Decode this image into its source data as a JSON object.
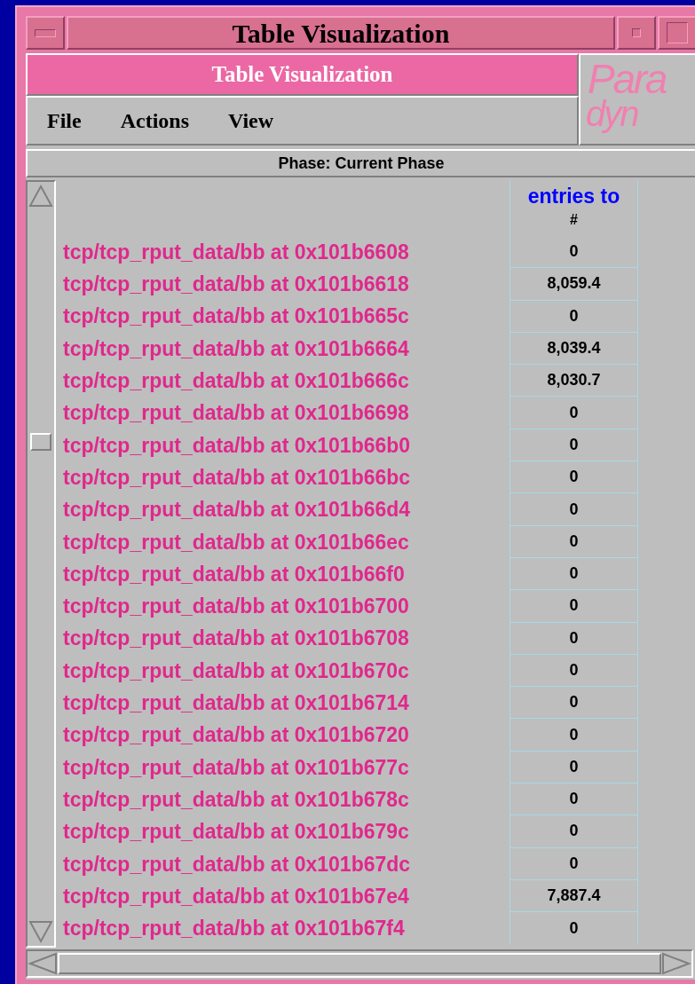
{
  "window": {
    "title": "Table Visualization"
  },
  "header": {
    "title": "Table Visualization",
    "logo": {
      "top": "Para",
      "bottom": "dyn"
    }
  },
  "menu": [
    "File",
    "Actions",
    "View"
  ],
  "phase": "Phase: Current Phase",
  "table": {
    "column_header": "entries to",
    "unit": "#",
    "rows": [
      {
        "name": "tcp/tcp_rput_data/bb at 0x101b6608",
        "value": "0"
      },
      {
        "name": "tcp/tcp_rput_data/bb at 0x101b6618",
        "value": "8,059.4"
      },
      {
        "name": "tcp/tcp_rput_data/bb at 0x101b665c",
        "value": "0"
      },
      {
        "name": "tcp/tcp_rput_data/bb at 0x101b6664",
        "value": "8,039.4"
      },
      {
        "name": "tcp/tcp_rput_data/bb at 0x101b666c",
        "value": "8,030.7"
      },
      {
        "name": "tcp/tcp_rput_data/bb at 0x101b6698",
        "value": "0"
      },
      {
        "name": "tcp/tcp_rput_data/bb at 0x101b66b0",
        "value": "0"
      },
      {
        "name": "tcp/tcp_rput_data/bb at 0x101b66bc",
        "value": "0"
      },
      {
        "name": "tcp/tcp_rput_data/bb at 0x101b66d4",
        "value": "0"
      },
      {
        "name": "tcp/tcp_rput_data/bb at 0x101b66ec",
        "value": "0"
      },
      {
        "name": "tcp/tcp_rput_data/bb at 0x101b66f0",
        "value": "0"
      },
      {
        "name": "tcp/tcp_rput_data/bb at 0x101b6700",
        "value": "0"
      },
      {
        "name": "tcp/tcp_rput_data/bb at 0x101b6708",
        "value": "0"
      },
      {
        "name": "tcp/tcp_rput_data/bb at 0x101b670c",
        "value": "0"
      },
      {
        "name": "tcp/tcp_rput_data/bb at 0x101b6714",
        "value": "0"
      },
      {
        "name": "tcp/tcp_rput_data/bb at 0x101b6720",
        "value": "0"
      },
      {
        "name": "tcp/tcp_rput_data/bb at 0x101b677c",
        "value": "0"
      },
      {
        "name": "tcp/tcp_rput_data/bb at 0x101b678c",
        "value": "0"
      },
      {
        "name": "tcp/tcp_rput_data/bb at 0x101b679c",
        "value": "0"
      },
      {
        "name": "tcp/tcp_rput_data/bb at 0x101b67dc",
        "value": "0"
      },
      {
        "name": "tcp/tcp_rput_data/bb at 0x101b67e4",
        "value": "7,887.4"
      },
      {
        "name": "tcp/tcp_rput_data/bb at 0x101b67f4",
        "value": "0"
      }
    ]
  }
}
